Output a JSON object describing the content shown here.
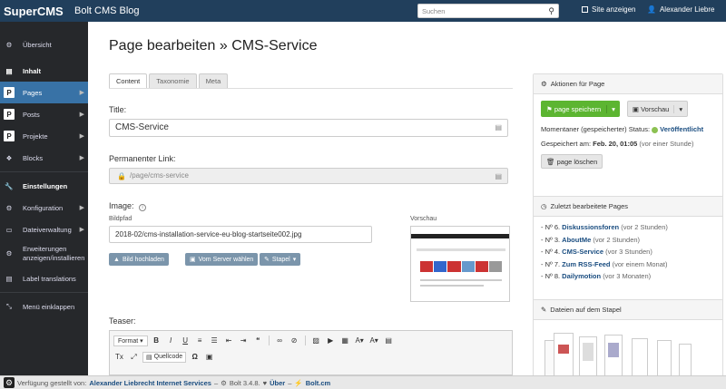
{
  "topbar": {
    "brand": "SuperCMS",
    "site_name": "Bolt CMS Blog",
    "search_placeholder": "Suchen",
    "view_site": "Site anzeigen",
    "user": "Alexander Liebre"
  },
  "sidebar": {
    "items": [
      {
        "label": "Übersicht"
      },
      {
        "label": "Inhalt"
      },
      {
        "label": "Pages"
      },
      {
        "label": "Posts"
      },
      {
        "label": "Projekte"
      },
      {
        "label": "Blocks"
      },
      {
        "label": "Einstellungen"
      },
      {
        "label": "Konfiguration"
      },
      {
        "label": "Dateiverwaltung"
      },
      {
        "label": "Erweiterungen anzeigen/installieren"
      },
      {
        "label": "Label translations"
      },
      {
        "label": "Menü einklappen"
      }
    ]
  },
  "main": {
    "title": "Page bearbeiten",
    "title_suffix": "» CMS-Service",
    "tabs": [
      "Content",
      "Taxonomie",
      "Meta"
    ],
    "title_label": "Title:",
    "title_value": "CMS-Service",
    "permalink_label": "Permanenter Link:",
    "permalink_value": "/page/cms-service",
    "image_label": "Image:",
    "image_path_label": "Bildpfad",
    "image_path_value": "2018-02/cms-installation-service-eu-blog-startseite002.jpg",
    "preview_label": "Vorschau",
    "btn_upload": "Bild hochladen",
    "btn_server": "Vom Server wählen",
    "btn_stack": "Stapel",
    "teaser_label": "Teaser:",
    "toolbar_format": "Format",
    "toolbar_source": "Quellcode"
  },
  "actions": {
    "title": "Aktionen für Page",
    "save": "page speichern",
    "preview": "Vorschau",
    "status_prefix": "Momentaner (gespeicherter) Status:",
    "status_value": "Veröffentlicht",
    "saved_prefix": "Gespeichert am:",
    "saved_date": "Feb. 20, 01:05",
    "saved_ago": "(vor einer Stunde)",
    "delete": "page löschen"
  },
  "recent": {
    "title": "Zuletzt bearbeitete Pages",
    "items": [
      {
        "prefix": "- Nº 6.",
        "name": "Diskussionsforen",
        "ago": "(vor 2 Stunden)"
      },
      {
        "prefix": "- Nº 3.",
        "name": "AboutMe",
        "ago": "(vor 2 Stunden)"
      },
      {
        "prefix": "- Nº 4.",
        "name": "CMS-Service",
        "ago": "(vor 3 Stunden)"
      },
      {
        "prefix": "- Nº 7.",
        "name": "Zum RSS-Feed",
        "ago": "(vor einem Monat)"
      },
      {
        "prefix": "- Nº 8.",
        "name": "Dailymotion",
        "ago": "(vor 3 Monaten)"
      }
    ]
  },
  "files": {
    "title": "Dateien auf dem Stapel"
  },
  "footer": {
    "text": "Verfügung gestellt von:",
    "company": "Alexander Liebrecht Internet Services",
    "version": "Bolt 3.4.8.",
    "about": "Über",
    "boltcm": "Bolt.cm"
  }
}
